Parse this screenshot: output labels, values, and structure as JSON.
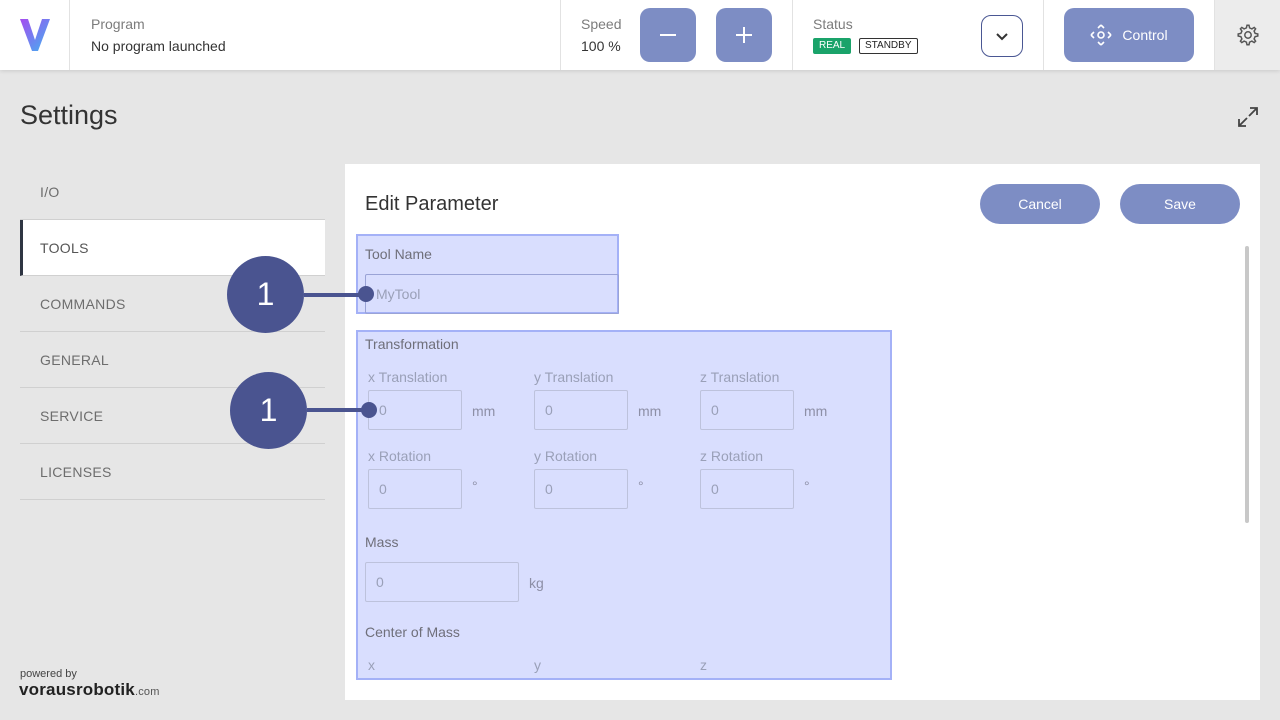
{
  "topbar": {
    "program_label": "Program",
    "program_value": "No program launched",
    "speed_label": "Speed",
    "speed_value": "100 %",
    "status_label": "Status",
    "badge_real": "REAL",
    "badge_standby": "STANDBY",
    "control_label": "Control"
  },
  "page": {
    "title": "Settings"
  },
  "sidebar": {
    "items": [
      {
        "label": "I/O"
      },
      {
        "label": "TOOLS"
      },
      {
        "label": "COMMANDS"
      },
      {
        "label": "GENERAL"
      },
      {
        "label": "SERVICE"
      },
      {
        "label": "LICENSES"
      }
    ],
    "powered_by": "powered by",
    "brand_bold": "vorausrobotik",
    "brand_suffix": ".com"
  },
  "panel": {
    "title": "Edit Parameter",
    "cancel_label": "Cancel",
    "save_label": "Save",
    "tool_name_label": "Tool Name",
    "tool_name_value": "MyTool",
    "transformation_label": "Transformation",
    "x_translation_label": "x Translation",
    "y_translation_label": "y Translation",
    "z_translation_label": "z Translation",
    "x_translation_value": "0",
    "y_translation_value": "0",
    "z_translation_value": "0",
    "translation_unit": "mm",
    "x_rotation_label": "x Rotation",
    "y_rotation_label": "y Rotation",
    "z_rotation_label": "z Rotation",
    "x_rotation_value": "0",
    "y_rotation_value": "0",
    "z_rotation_value": "0",
    "rotation_unit": "°",
    "mass_label": "Mass",
    "mass_value": "0",
    "mass_unit": "kg",
    "com_label": "Center of Mass",
    "com_x_label": "x",
    "com_y_label": "y",
    "com_z_label": "z"
  },
  "callouts": [
    {
      "number": "1"
    },
    {
      "number": "1"
    }
  ],
  "colors": {
    "accent": "#7d8dc4",
    "callout": "#4a5490",
    "badge_real": "#1aa36a",
    "highlight": "#d6dafd"
  }
}
